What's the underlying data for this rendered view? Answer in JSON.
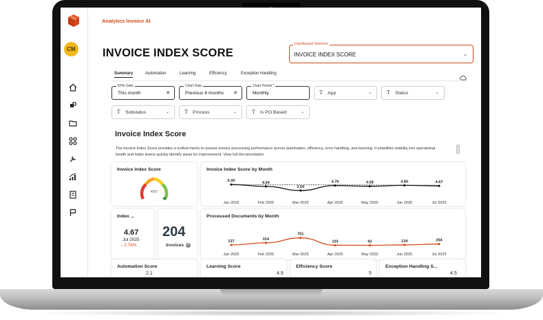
{
  "app": {
    "name": "Analytics Invoice AI",
    "avatar_initials": "CM",
    "brand_color": "#d14a1a"
  },
  "page": {
    "title": "INVOICE INDEX SCORE"
  },
  "dashboard_selector": {
    "label": "Dashboard Selector",
    "value": "INVOICE INDEX SCORE"
  },
  "tabs": [
    {
      "label": "Summary",
      "active": true
    },
    {
      "label": "Automation"
    },
    {
      "label": "Learning"
    },
    {
      "label": "Efficiency"
    },
    {
      "label": "Exception Handling"
    }
  ],
  "filters": {
    "kpis_date": {
      "label": "KPIs Date",
      "value": "This month"
    },
    "chart_date": {
      "label": "Chart Date",
      "value": "Previous 6 months"
    },
    "chart_period": {
      "label": "Chart Period *",
      "value": "Monthly"
    },
    "app": {
      "placeholder": "App"
    },
    "status": {
      "placeholder": "Status"
    },
    "substatus": {
      "placeholder": "Substatus"
    },
    "process": {
      "placeholder": "Process"
    },
    "is_po_based": {
      "placeholder": "Is PO Based"
    }
  },
  "section": {
    "title": "Invoice Index Score",
    "description": "The Invoice Index Score provides a unified metric to assess invoice processing performance across automation, efficiency, error handling, and learning. It simplifies visibility into operational health and helps teams quickly identify areas for improvement. View full documentation"
  },
  "gauge_card": {
    "title": "Invoice Index Score",
    "value": "4.67",
    "level": 4.67,
    "max": 5
  },
  "index_card": {
    "title": "Index ...",
    "value": "4.67",
    "period": "Jul 2025",
    "change": "2.76%"
  },
  "invoices_card": {
    "value": "204",
    "label": "Invoices"
  },
  "charts": {
    "index_by_month": {
      "title": "Invoice Index Score by Month",
      "categories": [
        "Jan 2025",
        "Feb 2025",
        "Mar 2025",
        "Apr 2025",
        "May 2025",
        "Jun 2025",
        "Jul 2025"
      ],
      "values": [
        5.0,
        4.54,
        3.54,
        4.76,
        4.58,
        4.8,
        4.67
      ],
      "labels": [
        "5.00",
        "4.54",
        "3.54",
        "4.76",
        "4.58",
        "4.80",
        "4.67"
      ],
      "ylim": [
        3.0,
        5.2
      ],
      "line_color": "#111111"
    },
    "processed_by_month": {
      "title": "Processed Documents by Month",
      "categories": [
        "Jan 2025",
        "Feb 2025",
        "Mar 2025",
        "Apr 2025",
        "May 2025",
        "Jun 2025",
        "Jul 2025"
      ],
      "values": [
        127,
        314,
        751,
        103,
        92,
        134,
        204
      ],
      "labels": [
        "127",
        "314",
        "751",
        "103",
        "92",
        "134",
        "204"
      ],
      "ylim": [
        0,
        1100
      ],
      "line_color": "#d14a1a"
    }
  },
  "chart_data": [
    {
      "type": "line",
      "title": "Invoice Index Score by Month",
      "categories": [
        "Jan 2025",
        "Feb 2025",
        "Mar 2025",
        "Apr 2025",
        "May 2025",
        "Jun 2025",
        "Jul 2025"
      ],
      "values": [
        5.0,
        4.54,
        3.54,
        4.76,
        4.58,
        4.8,
        4.67
      ],
      "xlabel": "",
      "ylabel": "",
      "grid": false
    },
    {
      "type": "line",
      "title": "Processed Documents by Month",
      "categories": [
        "Jan 2025",
        "Feb 2025",
        "Mar 2025",
        "Apr 2025",
        "May 2025",
        "Jun 2025",
        "Jul 2025"
      ],
      "values": [
        127,
        314,
        751,
        103,
        92,
        134,
        204
      ],
      "xlabel": "",
      "ylabel": "",
      "grid": false
    }
  ],
  "score_cards": [
    {
      "title": "Automation Score",
      "value": "2.1"
    },
    {
      "title": "Learning Score",
      "value": "4.9"
    },
    {
      "title": "Efficiency Score",
      "value": "5"
    },
    {
      "title": "Exception Handling S...",
      "value": "4.5"
    }
  ]
}
